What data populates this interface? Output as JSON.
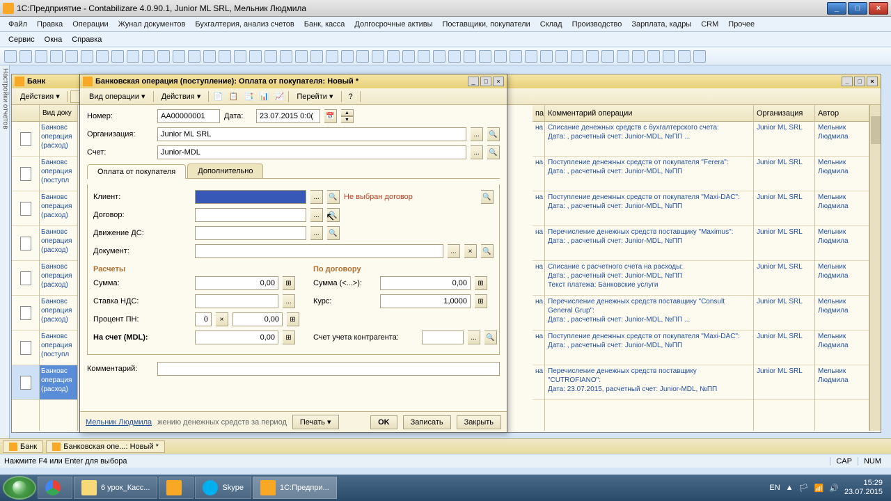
{
  "window": {
    "title": "1С:Предприятие - Contabilizare 4.0.90.1, Junior ML SRL, Мельник Людмила"
  },
  "menu": [
    "Файл",
    "Правка",
    "Операции",
    "Жунал документов",
    "Бухгалтерия, анализ счетов",
    "Банк, касса",
    "Долгосрочные активы",
    "Поставщики, покупатели",
    "Склад",
    "Производство",
    "Зарплата, кадры",
    "CRM",
    "Прочее"
  ],
  "menu2": [
    "Сервис",
    "Окна",
    "Справка"
  ],
  "bankwin": {
    "title": "Банк",
    "actions": "Действия ▾",
    "col_type": "Вид доку",
    "rows": [
      {
        "type": "Банковс\nоперация\n(расход)"
      },
      {
        "type": "Банковс\nоперация\n(поступл"
      },
      {
        "type": "Банковс\nоперация\n(расход)"
      },
      {
        "type": "Банковс\nоперация\n(расход)"
      },
      {
        "type": "Банковс\nоперация\n(расход)"
      },
      {
        "type": "Банковс\nоперация\n(расход)"
      },
      {
        "type": "Банковс\nоперация\n(поступл"
      },
      {
        "type": "Банковс\nоперация\n(расход)",
        "sel": true
      }
    ]
  },
  "righttable": {
    "col_hint": "па",
    "col_comment": "Комментарий операции",
    "col_org": "Организация",
    "col_author": "Автор",
    "rows": [
      {
        "c": "Списание денежных средств с бухгалтерского счета:\nДата: , расчетный счет: Junior-MDL, №ПП       ...",
        "o": "Junior ML SRL",
        "a": "Мельник\nЛюдмила"
      },
      {
        "c": "Поступление денежных средств от покупателя \"Ferera\":\nДата: , расчетный счет: Junior-MDL, №ПП",
        "o": "Junior ML SRL",
        "a": "Мельник\nЛюдмила"
      },
      {
        "c": "Поступление денежных средств от покупателя \"Maxi-DAC\":\nДата: , расчетный счет: Junior-MDL, №ПП",
        "o": "Junior ML SRL",
        "a": "Мельник\nЛюдмила"
      },
      {
        "c": "Перечисление денежных средств поставщику \"Maximus\":\nДата: , расчетный счет: Junior-MDL, №ПП",
        "o": "Junior ML SRL",
        "a": "Мельник\nЛюдмила"
      },
      {
        "c": "Списание с расчетного счета на расходы:\nДата: , расчетный счет: Junior-MDL, №ПП\nТекст платежа: Банковские услуги",
        "o": "Junior ML SRL",
        "a": "Мельник\nЛюдмила"
      },
      {
        "c": "Перечисление денежных средств поставщику \"Consult General Grup\":\nДата: , расчетный счет: Junior-MDL, №ПП       ...",
        "o": "Junior ML SRL",
        "a": "Мельник\nЛюдмила"
      },
      {
        "c": "Поступление денежных средств от покупателя \"Maxi-DAC\":\nДата: , расчетный счет: Junior-MDL, №ПП",
        "o": "Junior ML SRL",
        "a": "Мельник\nЛюдмила"
      },
      {
        "c": "Перечисление денежных средств поставщику \"CUTROFIANO\":\nДата: 23.07.2015, расчетный счет: Junior-MDL, №ПП",
        "o": "Junior ML SRL",
        "a": "Мельник\nЛюдмила"
      }
    ]
  },
  "doc": {
    "title": "Банковская операция (поступление): Оплата от покупателя: Новый *",
    "tb_vidop": "Вид операции ▾",
    "tb_actions": "Действия ▾",
    "tb_goto": "Перейти ▾",
    "lbl_number": "Номер:",
    "val_number": "АА00000001",
    "lbl_date": "Дата:",
    "val_date": "23.07.2015 0:0(",
    "lbl_org": "Организация:",
    "val_org": "Junior ML SRL",
    "lbl_schet": "Счет:",
    "val_schet": "Junior-MDL",
    "tab1": "Оплата от покупателя",
    "tab2": "Дополнительно",
    "lbl_client": "Клиент:",
    "lbl_dogovor": "Договор:",
    "lbl_dds": "Движение ДС:",
    "lbl_docu": "Документ:",
    "warn": "Не выбран договор",
    "sec_raschet": "Расчеты",
    "sec_podogovor": "По договору",
    "lbl_summa": "Сумма:",
    "val_summa": "0,00",
    "lbl_stavka": "Ставка НДС:",
    "lbl_procent": "Процент ПН:",
    "val_procent_num": "0",
    "val_procent": "0,00",
    "lbl_naschet": "На счет (MDL):",
    "val_naschet": "0,00",
    "lbl_summa2": "Сумма (<...>):",
    "val_summa2": "0,00",
    "lbl_kurs": "Курс:",
    "val_kurs": "1,0000",
    "lbl_schetkontra": "Счет учета контрагента:",
    "lbl_comment": "Комментарий:",
    "user": "Мельник Людмила",
    "linktext": "жению денежных средств за период",
    "btn_print": "Печать ▾",
    "btn_ok": "OK",
    "btn_write": "Записать",
    "btn_close": "Закрыть"
  },
  "winbar": {
    "item1": "Банк",
    "item2": "Банковская опе...: Новый *"
  },
  "status": {
    "hint": "Нажмите F4 или Enter для выбора",
    "cap": "CAP",
    "num": "NUM"
  },
  "taskbar": {
    "folder": "6 урок_Касс...",
    "skype": "Skype",
    "app": "1С:Предпри...",
    "lang": "EN",
    "time": "15:29",
    "date": "23.07.2015"
  }
}
